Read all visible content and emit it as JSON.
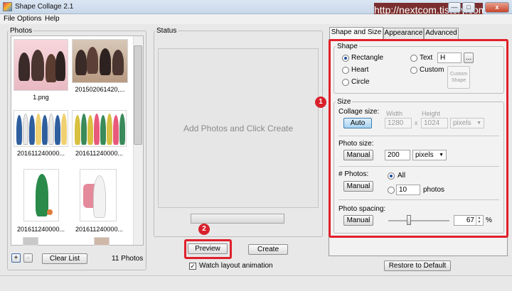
{
  "window": {
    "title": "Shape Collage 2.1",
    "watermark": "http://nextcom.tistory.com",
    "min_label": "—",
    "max_label": "□",
    "close_label": "x"
  },
  "menu": [
    "File",
    "Options",
    "Help"
  ],
  "photos_panel": {
    "label": "Photos",
    "thumbnails": [
      "1.png",
      "201502061420,...",
      "201611240000...",
      "201611240000...",
      "201611240000...",
      "201611240000..."
    ],
    "add_label": "+",
    "remove_label": "-",
    "clear_label": "Clear List",
    "count_label": "11 Photos"
  },
  "status_panel": {
    "label": "Status",
    "message": "Add Photos and Click Create",
    "progress": 0,
    "preview_label": "Preview",
    "create_label": "Create",
    "watch_label": "Watch layout animation",
    "watch_checked": true,
    "checkmark": "✓",
    "badge": "2"
  },
  "tabs": [
    "Shape and Size",
    "Appearance",
    "Advanced"
  ],
  "shape": {
    "label": "Shape",
    "rectangle": "Rectangle",
    "heart": "Heart",
    "circle": "Circle",
    "text": "Text",
    "text_value": "H",
    "browse_label": "...",
    "custom": "Custom",
    "custom_shape": "Custom Shape",
    "selected": "Rectangle"
  },
  "size": {
    "label": "Size",
    "badge": "1",
    "collage_size_label": "Collage size:",
    "auto_label": "Auto",
    "width_label": "Width",
    "height_label": "Height",
    "width_value": "1280",
    "times": "x",
    "height_value": "1024",
    "unit_value": "pixels",
    "photo_size_label": "Photo size:",
    "photo_manual_label": "Manual",
    "photo_size_value": "200",
    "photo_unit_value": "pixels",
    "num_photos_label": "# Photos:",
    "num_manual_label": "Manual",
    "all_label": "All",
    "photos_count_value": "10",
    "photos_unit": "photos",
    "spacing_label": "Photo spacing:",
    "spacing_manual_label": "Manual",
    "spacing_value": "67",
    "spacing_unit": "%"
  },
  "footer": {
    "restore_label": "Restore to Default"
  }
}
